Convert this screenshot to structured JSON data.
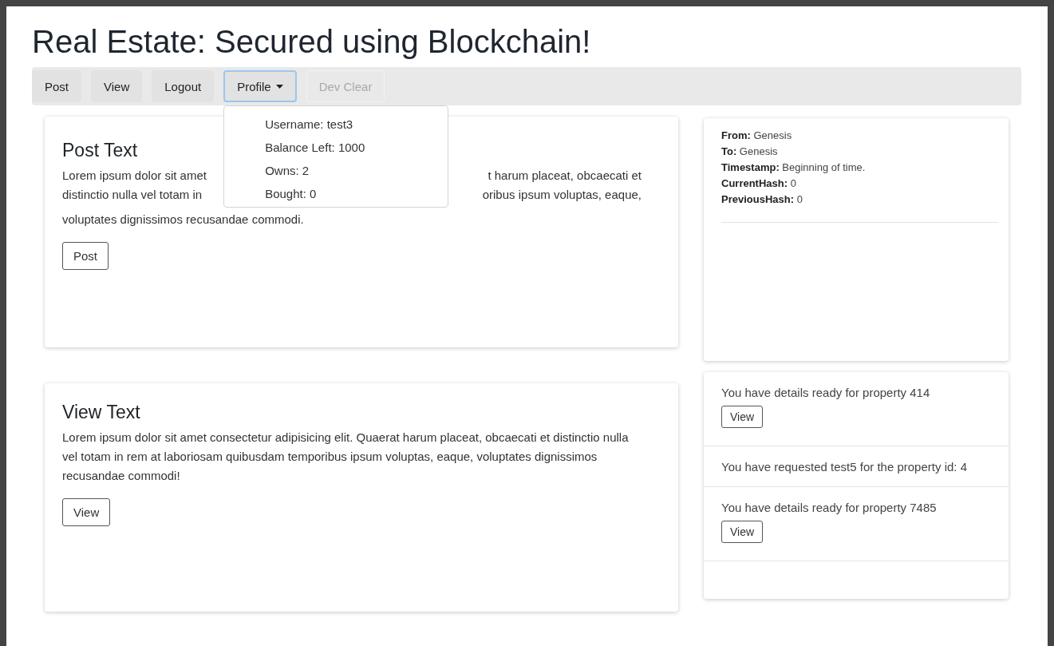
{
  "title": "Real Estate: Secured using Blockchain!",
  "nav": [
    {
      "label": "Post",
      "kind": "button",
      "disabled": false,
      "expanded": false
    },
    {
      "label": "View",
      "kind": "button",
      "disabled": false,
      "expanded": false
    },
    {
      "label": "Logout",
      "kind": "button",
      "disabled": false,
      "expanded": false
    },
    {
      "label": "Profile",
      "kind": "dropdown",
      "disabled": false,
      "expanded": true,
      "menu": [
        "Username: test3",
        "Balance Left: 1000",
        "Owns: 2",
        "Bought: 0"
      ]
    },
    {
      "label": "Dev Clear",
      "kind": "button",
      "disabled": true,
      "expanded": false
    }
  ],
  "cards": [
    {
      "heading": "Post Text",
      "lines": [
        {
          "left": "Lorem ipsum dolor sit amet",
          "right": "t harum placeat, obcaecati et"
        },
        {
          "left": "distinctio nulla vel totam in",
          "right": "oribus ipsum voluptas, eaque,"
        }
      ],
      "tail": "voluptates dignissimos recusandae commodi.",
      "button": "Post"
    },
    {
      "heading": "View Text",
      "paragraph": "Lorem ipsum dolor sit amet consectetur adipisicing elit. Quaerat harum placeat, obcaecati et distinctio nulla vel totam in rem at laboriosam quibusdam temporibus ipsum voluptas, eaque, voluptates dignissimos recusandae commodi!",
      "button": "View"
    }
  ],
  "block": [
    "**From:** Genesis",
    "**To:** Genesis",
    "**Timestamp:** Beginning of time.",
    "**CurrentHash:** 0",
    "**PreviousHash:** 0"
  ],
  "notifications": [
    {
      "kind": "action",
      "text": "You have details ready for property 414",
      "button": "View"
    },
    {
      "kind": "text",
      "text": "You have requested test5 for the property id: 4"
    },
    {
      "kind": "action",
      "text": "You have details ready for property 7485",
      "button": "View"
    }
  ]
}
